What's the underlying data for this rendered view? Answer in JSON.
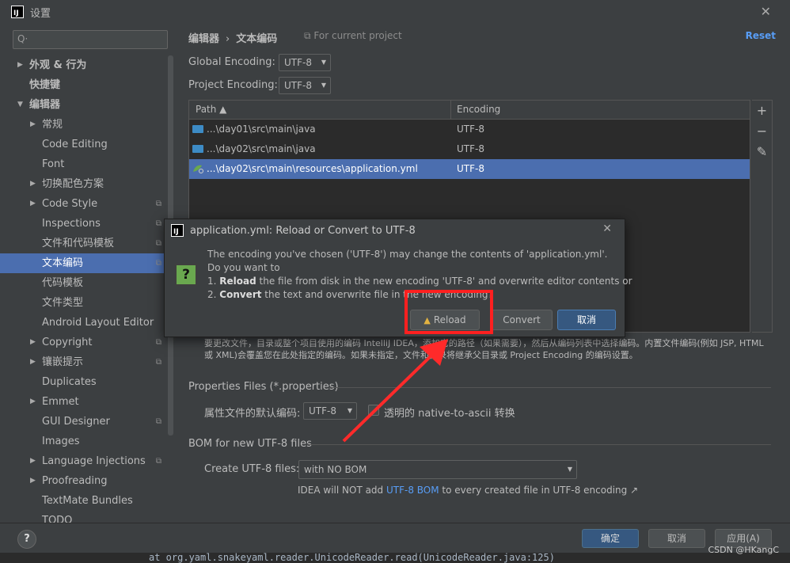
{
  "window": {
    "title": "设置"
  },
  "search": {
    "placeholder": "Q·"
  },
  "sidebar": {
    "items": [
      {
        "label": "外观 & 行为",
        "level": 0,
        "expand": "collapsed",
        "bold": true
      },
      {
        "label": "快捷键",
        "level": 0,
        "expand": "none",
        "bold": true
      },
      {
        "label": "编辑器",
        "level": 0,
        "expand": "expanded",
        "bold": true
      },
      {
        "label": "常规",
        "level": 1,
        "expand": "collapsed"
      },
      {
        "label": "Code Editing",
        "level": 1,
        "expand": "none"
      },
      {
        "label": "Font",
        "level": 1,
        "expand": "none"
      },
      {
        "label": "切换配色方案",
        "level": 1,
        "expand": "collapsed"
      },
      {
        "label": "Code Style",
        "level": 1,
        "expand": "collapsed",
        "cfg": true
      },
      {
        "label": "Inspections",
        "level": 1,
        "expand": "none",
        "cfg": true
      },
      {
        "label": "文件和代码模板",
        "level": 1,
        "expand": "none",
        "cfg": true
      },
      {
        "label": "文本编码",
        "level": 1,
        "expand": "none",
        "cfg": true,
        "selected": true
      },
      {
        "label": "代码模板",
        "level": 1,
        "expand": "none"
      },
      {
        "label": "文件类型",
        "level": 1,
        "expand": "none"
      },
      {
        "label": "Android Layout Editor",
        "level": 1,
        "expand": "none"
      },
      {
        "label": "Copyright",
        "level": 1,
        "expand": "collapsed",
        "cfg": true
      },
      {
        "label": "镶嵌提示",
        "level": 1,
        "expand": "collapsed",
        "cfg": true
      },
      {
        "label": "Duplicates",
        "level": 1,
        "expand": "none"
      },
      {
        "label": "Emmet",
        "level": 1,
        "expand": "collapsed"
      },
      {
        "label": "GUI Designer",
        "level": 1,
        "expand": "none",
        "cfg": true
      },
      {
        "label": "Images",
        "level": 1,
        "expand": "none"
      },
      {
        "label": "Language Injections",
        "level": 1,
        "expand": "collapsed",
        "cfg": true
      },
      {
        "label": "Proofreading",
        "level": 1,
        "expand": "collapsed"
      },
      {
        "label": "TextMate Bundles",
        "level": 1,
        "expand": "none"
      },
      {
        "label": "TODO",
        "level": 1,
        "expand": "none"
      }
    ]
  },
  "main": {
    "breadcrumb": [
      "编辑器",
      "文本编码"
    ],
    "breadcrumb_sep": "›",
    "for_project": "For current project",
    "reset": "Reset",
    "global_encoding_label": "Global Encoding:",
    "global_encoding_value": "UTF-8",
    "project_encoding_label": "Project Encoding:",
    "project_encoding_value": "UTF-8",
    "table": {
      "headers": [
        "Path ▲",
        "Encoding"
      ],
      "rows": [
        {
          "path": "...\\day01\\src\\main\\java",
          "encoding": "UTF-8",
          "icon": "folder-icon"
        },
        {
          "path": "...\\day02\\src\\main\\java",
          "encoding": "UTF-8",
          "icon": "folder-icon"
        },
        {
          "path": "...\\day02\\src\\main\\resources\\application.yml",
          "encoding": "UTF-8",
          "icon": "resource-icon",
          "selected": true
        }
      ]
    },
    "description": "要更改文件，目录或整个项目使用的编码 IntelliJ IDEA，添加它的路径（如果需要），然后从编码列表中选择编码。内置文件编码(例如 JSP, HTML 或 XML)会覆盖您在此处指定的编码。如果未指定，文件和目录将继承父目录或 Project Encoding 的编码设置。",
    "properties_title": "Properties Files (*.properties)",
    "properties_default_label": "属性文件的默认编码:",
    "properties_default_value": "UTF-8",
    "native_ascii_label": "透明的 native-to-ascii 转换",
    "bom_title": "BOM for new UTF-8 files",
    "create_utf8_label": "Create UTF-8 files:",
    "create_utf8_value": "with NO BOM",
    "bom_note_prefix": "IDEA will NOT add ",
    "bom_note_link": "UTF-8 BOM",
    "bom_note_suffix": " to every created file in UTF-8 encoding ↗"
  },
  "footer": {
    "help": "?",
    "ok": "确定",
    "cancel": "取消",
    "apply": "应用(A)"
  },
  "bottom_code": "at org.yaml.snakeyaml.reader.UnicodeReader.read(UnicodeReader.java:125)",
  "watermark": "CSDN @HKangC",
  "dialog": {
    "title": "application.yml: Reload or Convert to UTF-8",
    "line1": "The encoding you've chosen ('UTF-8') may change the contents of 'application.yml'.",
    "line2": "Do you want to",
    "line3_num": "1. ",
    "line3_bold": "Reload",
    "line3_rest": " the file from disk in the new encoding 'UTF-8' and overwrite editor contents or",
    "line4_num": "2. ",
    "line4_bold": "Convert",
    "line4_rest": " the text and overwrite file in the new encoding?",
    "reload": "Reload",
    "convert": "Convert",
    "cancel": "取消"
  },
  "colors": {
    "accent": "#4b6eaf",
    "link": "#589df6",
    "highlight": "#ff2020"
  }
}
